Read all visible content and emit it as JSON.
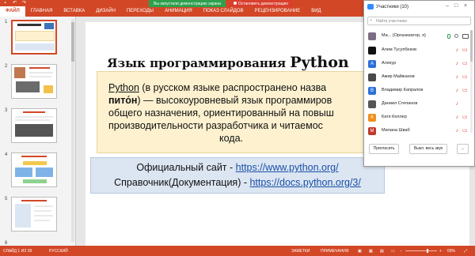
{
  "ribbon": {
    "tabs": [
      "ФАЙЛ",
      "ГЛАВНАЯ",
      "ВСТАВКА",
      "ДИЗАЙН",
      "ПЕРЕХОДЫ",
      "АНИМАЦИЯ",
      "ПОКАЗ СЛАЙДОВ",
      "РЕЦЕНЗИРОВАНИЕ",
      "ВИД"
    ],
    "active_tab": "ФАЙЛ"
  },
  "demo": {
    "status_text": "Вы запустили демонстрацию экрана",
    "stop_label": "Остановить демонстрацию"
  },
  "thumbnails": {
    "numbers": [
      "1",
      "2",
      "3",
      "4",
      "5",
      "6"
    ]
  },
  "slide": {
    "title_prefix": "Язык программирования",
    "title_word": "Python",
    "quote_lines": {
      "l1_word": "Python",
      "l1_rest": " (в русском языке распространено назва",
      "l2_word": "пито́н",
      "l2_rest": ") — высокоуровневый язык программиров",
      "l3": "общего назначения, ориентированный на повыш",
      "l4": "производительности разработчика и читаемос",
      "l5": "кода."
    },
    "site_label": "Официальный сайт - ",
    "site_url": "https://www.python.org/",
    "docs_label": "Справочник(Документация) - ",
    "docs_url": "https://docs.python.org/3/"
  },
  "participants": {
    "title": "Участники (10)",
    "search_placeholder": "Найти участника",
    "items": [
      {
        "name": "Ma...  (Организатор, я)",
        "initial": "",
        "color": "#7d6e86"
      },
      {
        "name": "Алем Тусупбеков",
        "initial": "",
        "color": "#111111"
      },
      {
        "name": "Алекур",
        "initial": "А",
        "color": "#2d6fd8"
      },
      {
        "name": "Амир Майжанов",
        "initial": "",
        "color": "#4a4a4a"
      },
      {
        "name": "Владимир Капралов",
        "initial": "В",
        "color": "#2d6fd8"
      },
      {
        "name": "Даниил Степанов",
        "initial": "",
        "color": "#555555"
      },
      {
        "name": "Катя Келлер",
        "initial": "К",
        "color": "#ef8f1c"
      },
      {
        "name": "Милана Шваб",
        "initial": "М",
        "color": "#c0392b"
      }
    ],
    "invite_label": "Пригласить",
    "mute_all_label": "Выкл. весь звук",
    "more_label": "..."
  },
  "statusbar": {
    "slide_info": "СЛАЙД 1 ИЗ 39",
    "language": "РУССКИЙ",
    "notes": "ЗАМЕТКИ",
    "comments": "ПРИМЕЧАНИЯ",
    "zoom": "69%"
  },
  "colors": {
    "accent": "#d24726",
    "demo_green": "#2ea04d",
    "demo_red": "#d93f2d",
    "quote_bg": "#fdf1cf",
    "links_bg": "#dce6f2"
  }
}
